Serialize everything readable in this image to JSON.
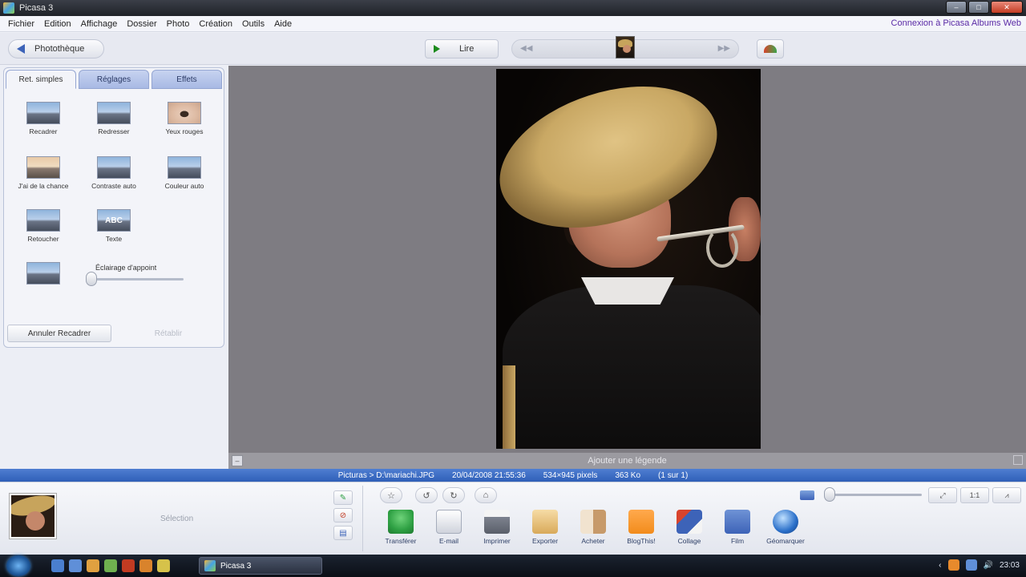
{
  "window": {
    "title": "Picasa 3"
  },
  "menu": {
    "items": [
      "Fichier",
      "Edition",
      "Affichage",
      "Dossier",
      "Photo",
      "Création",
      "Outils",
      "Aide"
    ],
    "account": "Connexion à Picasa Albums Web"
  },
  "toolbar": {
    "back_label": "Photothèque",
    "play_label": "Lire"
  },
  "left_panel": {
    "tabs": [
      "Ret. simples",
      "Réglages",
      "Effets"
    ],
    "tools": [
      "Recadrer",
      "Redresser",
      "Yeux rouges",
      "J'ai de la chance",
      "Contraste auto",
      "Couleur auto",
      "Retoucher",
      "Texte",
      ""
    ],
    "text_icon": "ABC",
    "slider_label": "Éclairage d'appoint",
    "slider_value": 0,
    "undo_label": "Annuler Recadrer",
    "redo_label": "Rétablir"
  },
  "viewer": {
    "caption_placeholder": "Ajouter une légende"
  },
  "status": {
    "path": "Picturas > D:\\mariachi.JPG",
    "date": "20/04/2008 21:55:36",
    "dimensions": "534×945 pixels",
    "size": "363 Ko",
    "index": "(1 sur 1)"
  },
  "tray": {
    "selection_label": "Sélection",
    "actions": [
      {
        "label": "Transférer",
        "color": "#2ea043"
      },
      {
        "label": "E-mail",
        "color": "#d9dce4"
      },
      {
        "label": "Imprimer",
        "color": "#8a8f9a"
      },
      {
        "label": "Exporter",
        "color": "#e8c07a"
      },
      {
        "label": "Acheter",
        "color": "#c79a6a"
      },
      {
        "label": "BlogThis!",
        "color": "#f28c1c"
      },
      {
        "label": "Collage",
        "color": "#3d63b8"
      },
      {
        "label": "Film",
        "color": "#4a72c4"
      },
      {
        "label": "Géomarquer",
        "color": "#2a6fc9"
      }
    ]
  },
  "taskbar": {
    "task_title": "Picasa 3",
    "time": "23:03"
  }
}
